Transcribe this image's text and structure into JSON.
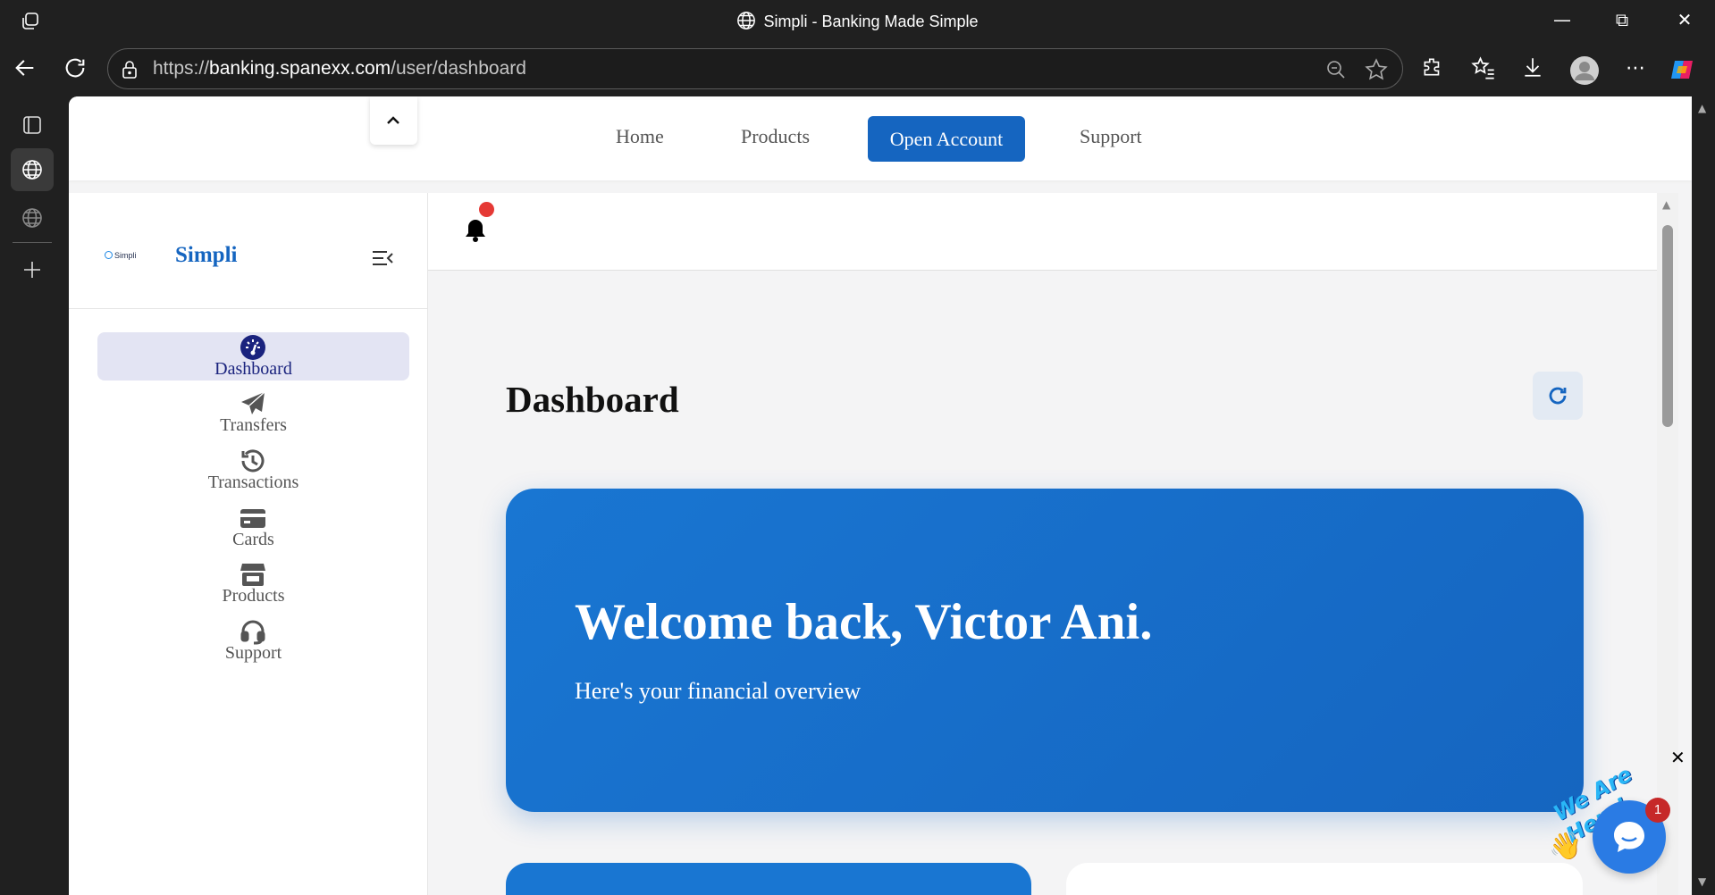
{
  "browser": {
    "window_title": "Simpli - Banking Made Simple",
    "url_prefix": "https://",
    "url_host": "banking.spanexx.com",
    "url_path": "/user/dashboard"
  },
  "topnav": {
    "links": [
      "Home",
      "Products",
      "Open Account",
      "Support"
    ]
  },
  "sidebar": {
    "logo_text": "Simpli",
    "brand_name": "Simpli",
    "items": [
      {
        "label": "Dashboard",
        "icon": "gauge-icon",
        "active": true
      },
      {
        "label": "Transfers",
        "icon": "paper-plane-icon"
      },
      {
        "label": "Transactions",
        "icon": "history-icon"
      },
      {
        "label": "Cards",
        "icon": "credit-card-icon"
      },
      {
        "label": "Products",
        "icon": "store-icon"
      },
      {
        "label": "Support",
        "icon": "headset-icon"
      }
    ]
  },
  "main": {
    "page_title": "Dashboard",
    "welcome_title": "Welcome back, Victor Ani.",
    "welcome_subtitle": "Here's your financial overview"
  },
  "chat_widget": {
    "tagline": "We Are Here!",
    "badge_count": "1"
  },
  "colors": {
    "primary": "#1565c0",
    "notification": "#e53935",
    "sidebar_active_bg": "#e3e4f3"
  }
}
